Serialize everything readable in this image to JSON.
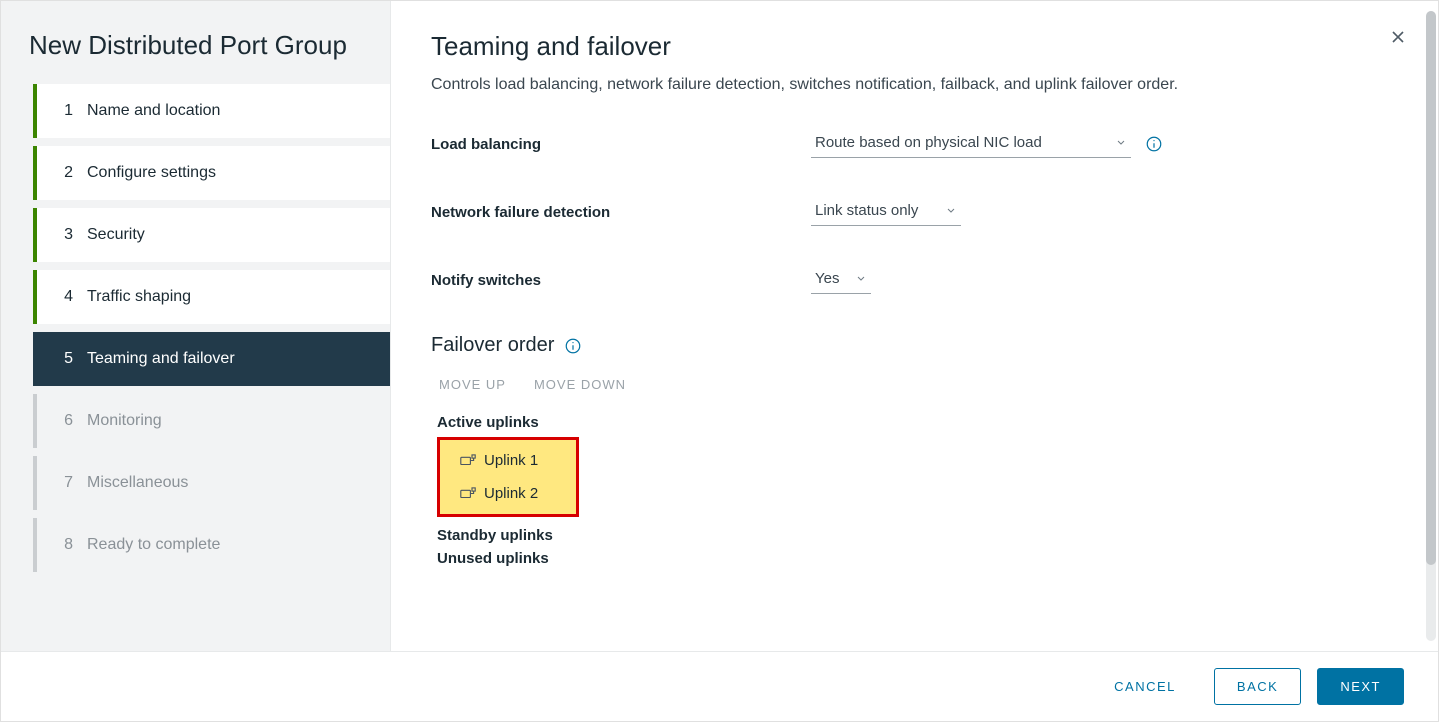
{
  "wizard": {
    "title": "New Distributed Port Group",
    "steps": [
      {
        "num": "1",
        "label": "Name and location",
        "state": "done"
      },
      {
        "num": "2",
        "label": "Configure settings",
        "state": "done"
      },
      {
        "num": "3",
        "label": "Security",
        "state": "done"
      },
      {
        "num": "4",
        "label": "Traffic shaping",
        "state": "done"
      },
      {
        "num": "5",
        "label": "Teaming and failover",
        "state": "active"
      },
      {
        "num": "6",
        "label": "Monitoring",
        "state": "future"
      },
      {
        "num": "7",
        "label": "Miscellaneous",
        "state": "future"
      },
      {
        "num": "8",
        "label": "Ready to complete",
        "state": "future"
      }
    ]
  },
  "main": {
    "title": "Teaming and failover",
    "description": "Controls load balancing, network failure detection, switches notification, failback, and uplink failover order.",
    "fields": {
      "load_balancing": {
        "label": "Load balancing",
        "value": "Route based on physical NIC load"
      },
      "failure_detection": {
        "label": "Network failure detection",
        "value": "Link status only"
      },
      "notify_switches": {
        "label": "Notify switches",
        "value": "Yes"
      }
    },
    "failover": {
      "title": "Failover order",
      "move_up": "MOVE UP",
      "move_down": "MOVE DOWN",
      "active_label": "Active uplinks",
      "standby_label": "Standby uplinks",
      "unused_label": "Unused uplinks",
      "active_uplinks": [
        "Uplink 1",
        "Uplink 2"
      ]
    }
  },
  "footer": {
    "cancel": "CANCEL",
    "back": "BACK",
    "next": "NEXT"
  },
  "colors": {
    "primary": "#0072a3",
    "highlight_border": "#d60000",
    "highlight_fill": "#ffe880"
  }
}
